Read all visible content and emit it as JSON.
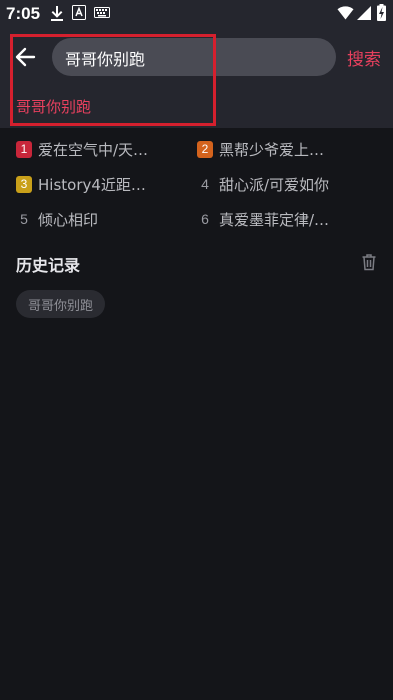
{
  "status_bar": {
    "time": "7:05",
    "icons": [
      "download-icon",
      "a-box-icon",
      "keyboard-icon",
      "wifi-icon",
      "signal-icon",
      "battery-charging-icon"
    ]
  },
  "search": {
    "query": "哥哥你别跑",
    "submit_label": "搜索",
    "suggestion": "哥哥你别跑"
  },
  "hot_searches": [
    {
      "rank": "1",
      "text": "爱在空气中/天…",
      "badge_color": "#c8263a"
    },
    {
      "rank": "2",
      "text": "黑帮少爷爱上…",
      "badge_color": "#d4631d"
    },
    {
      "rank": "3",
      "text": "History4近距…",
      "badge_color": "#c9a01a"
    },
    {
      "rank": "4",
      "text": "甜心派/可爱如你",
      "badge_color": null
    },
    {
      "rank": "5",
      "text": "倾心相印",
      "badge_color": null
    },
    {
      "rank": "6",
      "text": "真爱墨菲定律/…",
      "badge_color": null
    }
  ],
  "history": {
    "title": "历史记录",
    "items": [
      "哥哥你别跑"
    ]
  },
  "colors": {
    "accent": "#e8405e",
    "header_bg": "#25262e",
    "page_bg": "#141519"
  }
}
